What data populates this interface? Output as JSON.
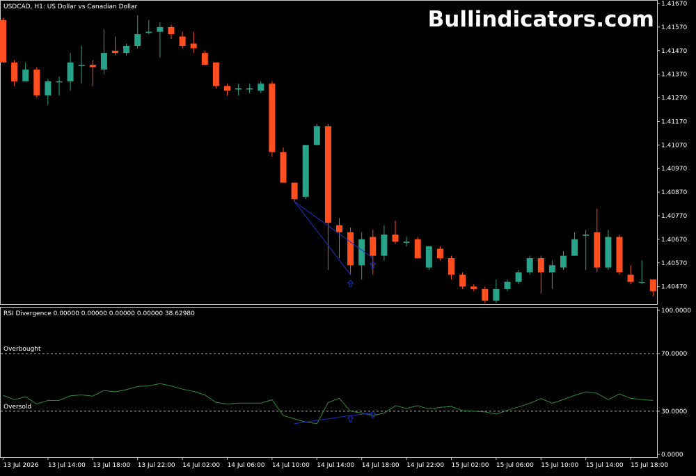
{
  "window": {
    "symbol_line": "USDCAD, H1:  US Dollar vs Canadian Dollar",
    "watermark": "Bullindicators.com"
  },
  "colors": {
    "background": "#000000",
    "frame": "#c8c8c8",
    "bull": "#27a38a",
    "bear": "#ff4e1f",
    "rsi_line": "#2e8b3a",
    "divergence": "#1f2dbf",
    "level_line": "#b4b4b4",
    "text": "#ffffff"
  },
  "chart_data": [
    {
      "type": "candlestick",
      "title": "USDCAD, H1:  US Dollar vs Canadian Dollar",
      "ylim": [
        1.4041,
        1.4167
      ],
      "y_ticks": [
        "1.41670",
        "1.41570",
        "1.41470",
        "1.41370",
        "1.41270",
        "1.41170",
        "1.41070",
        "1.40970",
        "1.40870",
        "1.40770",
        "1.40670",
        "1.40570",
        "1.40470"
      ],
      "y_tick_values": [
        1.4167,
        1.4157,
        1.4147,
        1.4137,
        1.4127,
        1.4117,
        1.4107,
        1.4097,
        1.4087,
        1.4077,
        1.4067,
        1.4057,
        1.4047
      ],
      "candles": [
        {
          "o": 1.416,
          "h": 1.4161,
          "l": 1.4142,
          "c": 1.4142
        },
        {
          "o": 1.4142,
          "h": 1.4143,
          "l": 1.4132,
          "c": 1.4134
        },
        {
          "o": 1.4134,
          "h": 1.4142,
          "l": 1.4134,
          "c": 1.4139
        },
        {
          "o": 1.4139,
          "h": 1.414,
          "l": 1.4127,
          "c": 1.4128
        },
        {
          "o": 1.4128,
          "h": 1.4135,
          "l": 1.4124,
          "c": 1.4134
        },
        {
          "o": 1.4134,
          "h": 1.4136,
          "l": 1.4128,
          "c": 1.4134
        },
        {
          "o": 1.4134,
          "h": 1.4146,
          "l": 1.413,
          "c": 1.4142
        },
        {
          "o": 1.4141,
          "h": 1.4149,
          "l": 1.4133,
          "c": 1.4141
        },
        {
          "o": 1.4141,
          "h": 1.4143,
          "l": 1.4132,
          "c": 1.414
        },
        {
          "o": 1.4139,
          "h": 1.4156,
          "l": 1.4137,
          "c": 1.4146
        },
        {
          "o": 1.4147,
          "h": 1.4153,
          "l": 1.4145,
          "c": 1.4146
        },
        {
          "o": 1.4146,
          "h": 1.415,
          "l": 1.4145,
          "c": 1.4149
        },
        {
          "o": 1.4149,
          "h": 1.4162,
          "l": 1.4148,
          "c": 1.4154
        },
        {
          "o": 1.4155,
          "h": 1.416,
          "l": 1.4154,
          "c": 1.4155
        },
        {
          "o": 1.4155,
          "h": 1.4159,
          "l": 1.4144,
          "c": 1.4157
        },
        {
          "o": 1.4157,
          "h": 1.4158,
          "l": 1.4152,
          "c": 1.4154
        },
        {
          "o": 1.4153,
          "h": 1.4155,
          "l": 1.4148,
          "c": 1.4149
        },
        {
          "o": 1.415,
          "h": 1.4155,
          "l": 1.4146,
          "c": 1.4148
        },
        {
          "o": 1.4146,
          "h": 1.4147,
          "l": 1.4141,
          "c": 1.4141
        },
        {
          "o": 1.4142,
          "h": 1.4142,
          "l": 1.4131,
          "c": 1.4132
        },
        {
          "o": 1.4132,
          "h": 1.4133,
          "l": 1.4128,
          "c": 1.413
        },
        {
          "o": 1.4131,
          "h": 1.4133,
          "l": 1.4128,
          "c": 1.4131
        },
        {
          "o": 1.4131,
          "h": 1.4133,
          "l": 1.4129,
          "c": 1.4131
        },
        {
          "o": 1.413,
          "h": 1.4134,
          "l": 1.4129,
          "c": 1.4133
        },
        {
          "o": 1.4133,
          "h": 1.4134,
          "l": 1.4102,
          "c": 1.4104
        },
        {
          "o": 1.4104,
          "h": 1.4106,
          "l": 1.4091,
          "c": 1.4091
        },
        {
          "o": 1.4091,
          "h": 1.4091,
          "l": 1.4083,
          "c": 1.4084
        },
        {
          "o": 1.4085,
          "h": 1.4107,
          "l": 1.4084,
          "c": 1.4107
        },
        {
          "o": 1.4107,
          "h": 1.4116,
          "l": 1.4107,
          "c": 1.4115
        },
        {
          "o": 1.4115,
          "h": 1.4116,
          "l": 1.4054,
          "c": 1.4074
        },
        {
          "o": 1.4073,
          "h": 1.4076,
          "l": 1.4059,
          "c": 1.407
        },
        {
          "o": 1.407,
          "h": 1.4072,
          "l": 1.4052,
          "c": 1.4056
        },
        {
          "o": 1.4056,
          "h": 1.407,
          "l": 1.405,
          "c": 1.4067
        },
        {
          "o": 1.4068,
          "h": 1.4071,
          "l": 1.4052,
          "c": 1.406
        },
        {
          "o": 1.406,
          "h": 1.4073,
          "l": 1.4058,
          "c": 1.4069
        },
        {
          "o": 1.4069,
          "h": 1.4075,
          "l": 1.4065,
          "c": 1.4066
        },
        {
          "o": 1.4066,
          "h": 1.4068,
          "l": 1.4064,
          "c": 1.4066
        },
        {
          "o": 1.4067,
          "h": 1.4068,
          "l": 1.4059,
          "c": 1.4059
        },
        {
          "o": 1.4055,
          "h": 1.4064,
          "l": 1.4054,
          "c": 1.4064
        },
        {
          "o": 1.4063,
          "h": 1.4064,
          "l": 1.4058,
          "c": 1.4059
        },
        {
          "o": 1.4059,
          "h": 1.406,
          "l": 1.405,
          "c": 1.4052
        },
        {
          "o": 1.4052,
          "h": 1.4053,
          "l": 1.4046,
          "c": 1.4047
        },
        {
          "o": 1.4047,
          "h": 1.4048,
          "l": 1.4045,
          "c": 1.4046
        },
        {
          "o": 1.4046,
          "h": 1.4047,
          "l": 1.404,
          "c": 1.4041
        },
        {
          "o": 1.4041,
          "h": 1.405,
          "l": 1.404,
          "c": 1.4046
        },
        {
          "o": 1.4046,
          "h": 1.405,
          "l": 1.4045,
          "c": 1.4049
        },
        {
          "o": 1.4049,
          "h": 1.4054,
          "l": 1.4048,
          "c": 1.4053
        },
        {
          "o": 1.4053,
          "h": 1.406,
          "l": 1.4052,
          "c": 1.4059
        },
        {
          "o": 1.4059,
          "h": 1.406,
          "l": 1.4044,
          "c": 1.4053
        },
        {
          "o": 1.4053,
          "h": 1.4058,
          "l": 1.4046,
          "c": 1.4056
        },
        {
          "o": 1.4055,
          "h": 1.4062,
          "l": 1.4054,
          "c": 1.406
        },
        {
          "o": 1.406,
          "h": 1.407,
          "l": 1.406,
          "c": 1.4067
        },
        {
          "o": 1.4069,
          "h": 1.4071,
          "l": 1.4054,
          "c": 1.4069
        },
        {
          "o": 1.407,
          "h": 1.408,
          "l": 1.4053,
          "c": 1.4055
        },
        {
          "o": 1.4055,
          "h": 1.4071,
          "l": 1.4054,
          "c": 1.4068
        },
        {
          "o": 1.4068,
          "h": 1.4069,
          "l": 1.4052,
          "c": 1.4053
        },
        {
          "o": 1.4052,
          "h": 1.4056,
          "l": 1.4048,
          "c": 1.4049
        },
        {
          "o": 1.4049,
          "h": 1.4058,
          "l": 1.4048,
          "c": 1.4049
        },
        {
          "o": 1.405,
          "h": 1.405,
          "l": 1.4043,
          "c": 1.4045
        }
      ]
    },
    {
      "type": "line",
      "title": "RSI Divergence 0.00000 0.00000 0.00000 0.00000 38.62980",
      "ylim": [
        0,
        100
      ],
      "y_ticks": [
        "100.0000",
        "70.0000",
        "30.0000",
        "0.0000"
      ],
      "y_tick_values": [
        100,
        70,
        30,
        0
      ],
      "levels": [
        {
          "label": "Overbought",
          "value": 70
        },
        {
          "label": "Oversold",
          "value": 30
        }
      ],
      "series": [
        {
          "values": [
            41.0,
            38.0,
            40.0,
            35.0,
            37.5,
            37.5,
            40.7,
            41.3,
            40.5,
            44.4,
            43.5,
            45.0,
            47.2,
            47.6,
            49.2,
            47.6,
            45.3,
            43.7,
            41.3,
            36.1,
            35.0,
            35.6,
            35.6,
            35.6,
            37.9,
            27.0,
            24.7,
            22.5,
            21.4,
            36.0,
            39.0,
            30.0,
            28.8,
            27.0,
            28.7,
            33.8,
            32.0,
            33.8,
            31.5,
            32.7,
            33.3,
            30.4,
            30.0,
            29.5,
            28.0,
            30.6,
            33.0,
            35.5,
            38.8,
            35.5,
            38.1,
            41.0,
            43.5,
            42.4,
            38.0,
            42.0,
            39.0,
            38.0,
            37.5
          ]
        }
      ]
    }
  ],
  "divergence_marks": {
    "price_line": {
      "from": {
        "bar": 26,
        "value": 1.4083
      },
      "to": {
        "bar": 31,
        "value": 1.4052
      }
    },
    "price_line2": {
      "from": {
        "bar": 26,
        "value": 1.4083
      },
      "to": {
        "bar": 33,
        "value": 1.4059
      }
    },
    "rsi_line": {
      "from": {
        "bar": 26,
        "value": 21.4
      },
      "to": {
        "bar": 31,
        "value": 27.0
      }
    },
    "rsi_line2": {
      "from": {
        "bar": 31,
        "value": 27.0
      },
      "to": {
        "bar": 33,
        "value": 28.8
      }
    },
    "price_arrows": [
      {
        "bar": 31,
        "value": 1.4049
      },
      {
        "bar": 33,
        "value": 1.4057
      }
    ],
    "rsi_arrows": [
      {
        "bar": 31,
        "value": 26.0
      },
      {
        "bar": 33,
        "value": 29.0
      }
    ]
  },
  "x_axis": {
    "labels": [
      {
        "bar": 0,
        "text": "13 Jul 2026"
      },
      {
        "bar": 4,
        "text": "13 Jul 14:00"
      },
      {
        "bar": 8,
        "text": "13 Jul 18:00"
      },
      {
        "bar": 12,
        "text": "13 Jul 22:00"
      },
      {
        "bar": 16,
        "text": "14 Jul 02:00"
      },
      {
        "bar": 20,
        "text": "14 Jul 06:00"
      },
      {
        "bar": 24,
        "text": "14 Jul 10:00"
      },
      {
        "bar": 28,
        "text": "14 Jul 14:00"
      },
      {
        "bar": 32,
        "text": "14 Jul 18:00"
      },
      {
        "bar": 36,
        "text": "14 Jul 22:00"
      },
      {
        "bar": 40,
        "text": "15 Jul 02:00"
      },
      {
        "bar": 44,
        "text": "15 Jul 06:00"
      },
      {
        "bar": 48,
        "text": "15 Jul 10:00"
      },
      {
        "bar": 52,
        "text": "15 Jul 14:00"
      },
      {
        "bar": 56,
        "text": "15 Jul 18:00"
      }
    ]
  }
}
